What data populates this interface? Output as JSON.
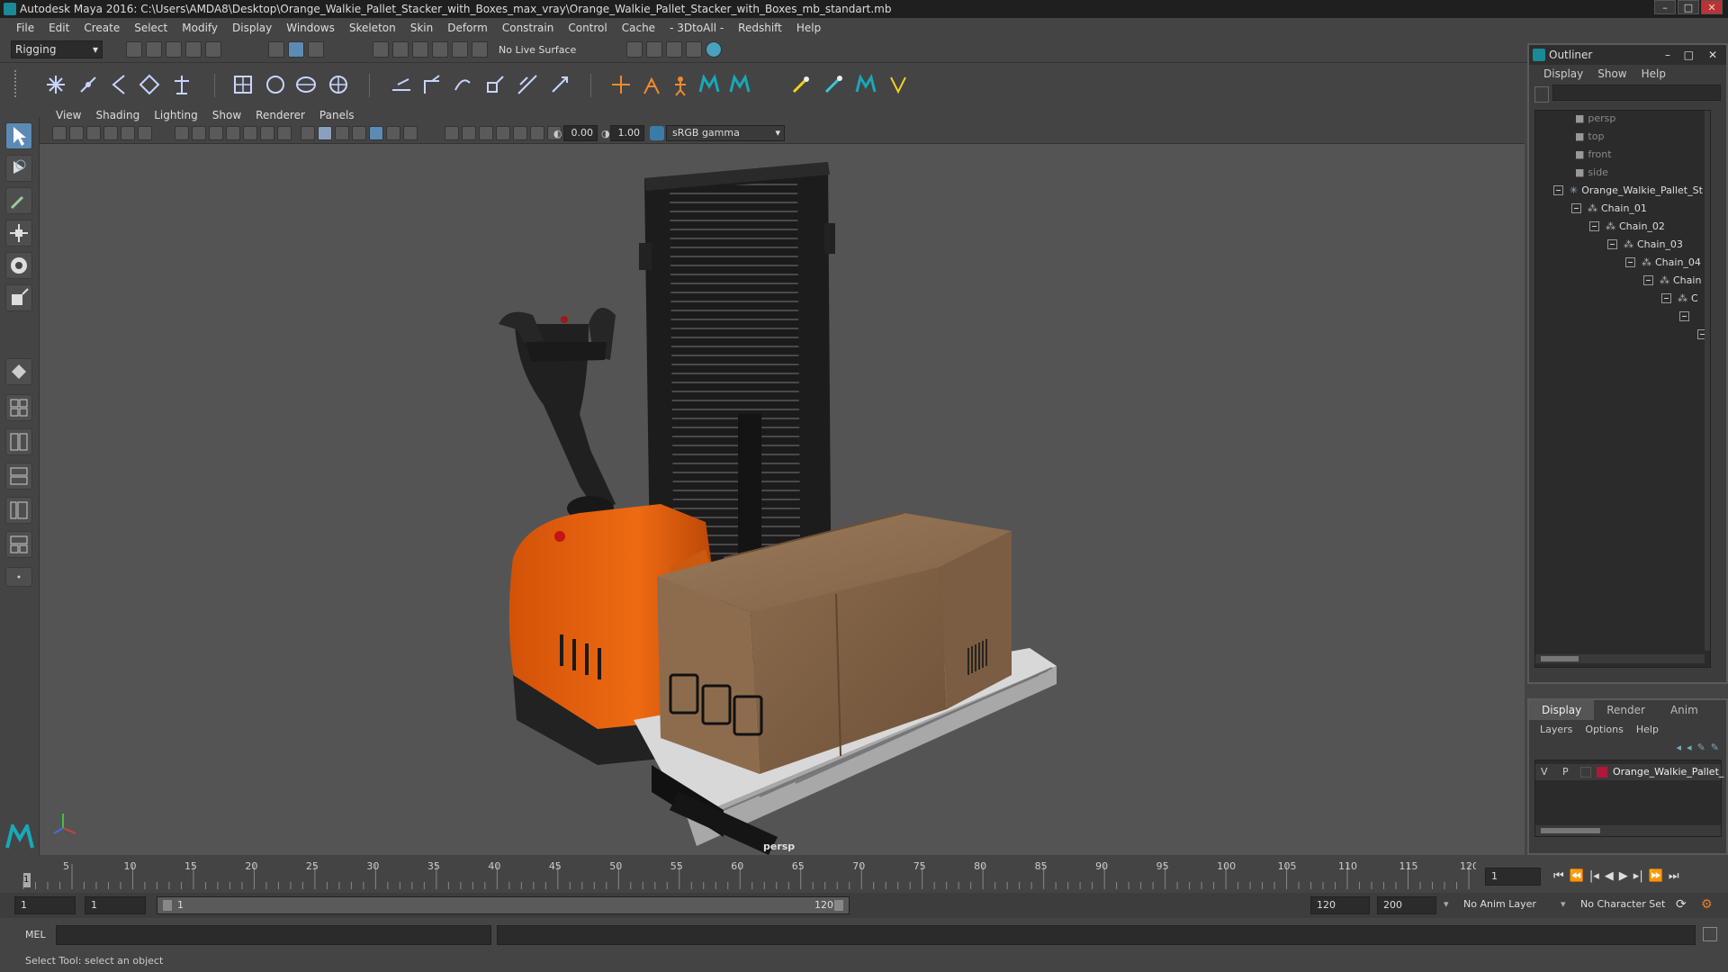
{
  "window": {
    "title": "Autodesk Maya 2016: C:\\Users\\AMDA8\\Desktop\\Orange_Walkie_Pallet_Stacker_with_Boxes_max_vray\\Orange_Walkie_Pallet_Stacker_with_Boxes_mb_standart.mb",
    "minimize": "–",
    "maximize": "□",
    "close": "✕"
  },
  "menus": [
    "File",
    "Edit",
    "Create",
    "Select",
    "Modify",
    "Display",
    "Windows",
    "Skeleton",
    "Skin",
    "Deform",
    "Constrain",
    "Control",
    "Cache",
    "- 3DtoAll -",
    "Redshift",
    "Help"
  ],
  "toolbar": {
    "mode": "Rigging",
    "live_surface": "No Live Surface"
  },
  "panel_menus": [
    "View",
    "Shading",
    "Lighting",
    "Show",
    "Renderer",
    "Panels"
  ],
  "panel_toolbar": {
    "exposure": "0.00",
    "gamma": "1.00",
    "colorspace": "sRGB gamma"
  },
  "viewport": {
    "camera_label": "persp"
  },
  "outliner": {
    "title": "Outliner",
    "menus": [
      "Display",
      "Show",
      "Help"
    ],
    "items": [
      {
        "label": "persp",
        "type": "camera"
      },
      {
        "label": "top",
        "type": "camera"
      },
      {
        "label": "front",
        "type": "camera"
      },
      {
        "label": "side",
        "type": "camera"
      },
      {
        "label": "Orange_Walkie_Pallet_St",
        "type": "root"
      },
      {
        "label": "Chain_01",
        "type": "joint"
      },
      {
        "label": "Chain_02",
        "type": "joint"
      },
      {
        "label": "Chain_03",
        "type": "joint"
      },
      {
        "label": "Chain_04",
        "type": "joint"
      },
      {
        "label": "Chain",
        "type": "joint"
      },
      {
        "label": "C",
        "type": "joint"
      }
    ]
  },
  "layer_panel": {
    "tabs": [
      "Display",
      "Render",
      "Anim"
    ],
    "menus": [
      "Layers",
      "Options",
      "Help"
    ],
    "layer": {
      "v": "V",
      "p": "P",
      "name": "Orange_Walkie_Pallet_",
      "color": "#b0173a"
    }
  },
  "timeline": {
    "ticks": [
      "5",
      "10",
      "15",
      "20",
      "25",
      "30",
      "35",
      "40",
      "45",
      "50",
      "55",
      "60",
      "65",
      "70",
      "75",
      "80",
      "85",
      "90",
      "95",
      "100",
      "105",
      "110",
      "115",
      "120"
    ],
    "current_marker": "1",
    "current_frame": "1"
  },
  "range": {
    "start": "1",
    "anim_start": "1",
    "slider_start": "1",
    "slider_end": "120",
    "anim_end": "120",
    "end": "200",
    "anim_layer": "No Anim Layer",
    "char_set": "No Character Set"
  },
  "command": {
    "lang": "MEL"
  },
  "help_line": "Select Tool: select an object"
}
